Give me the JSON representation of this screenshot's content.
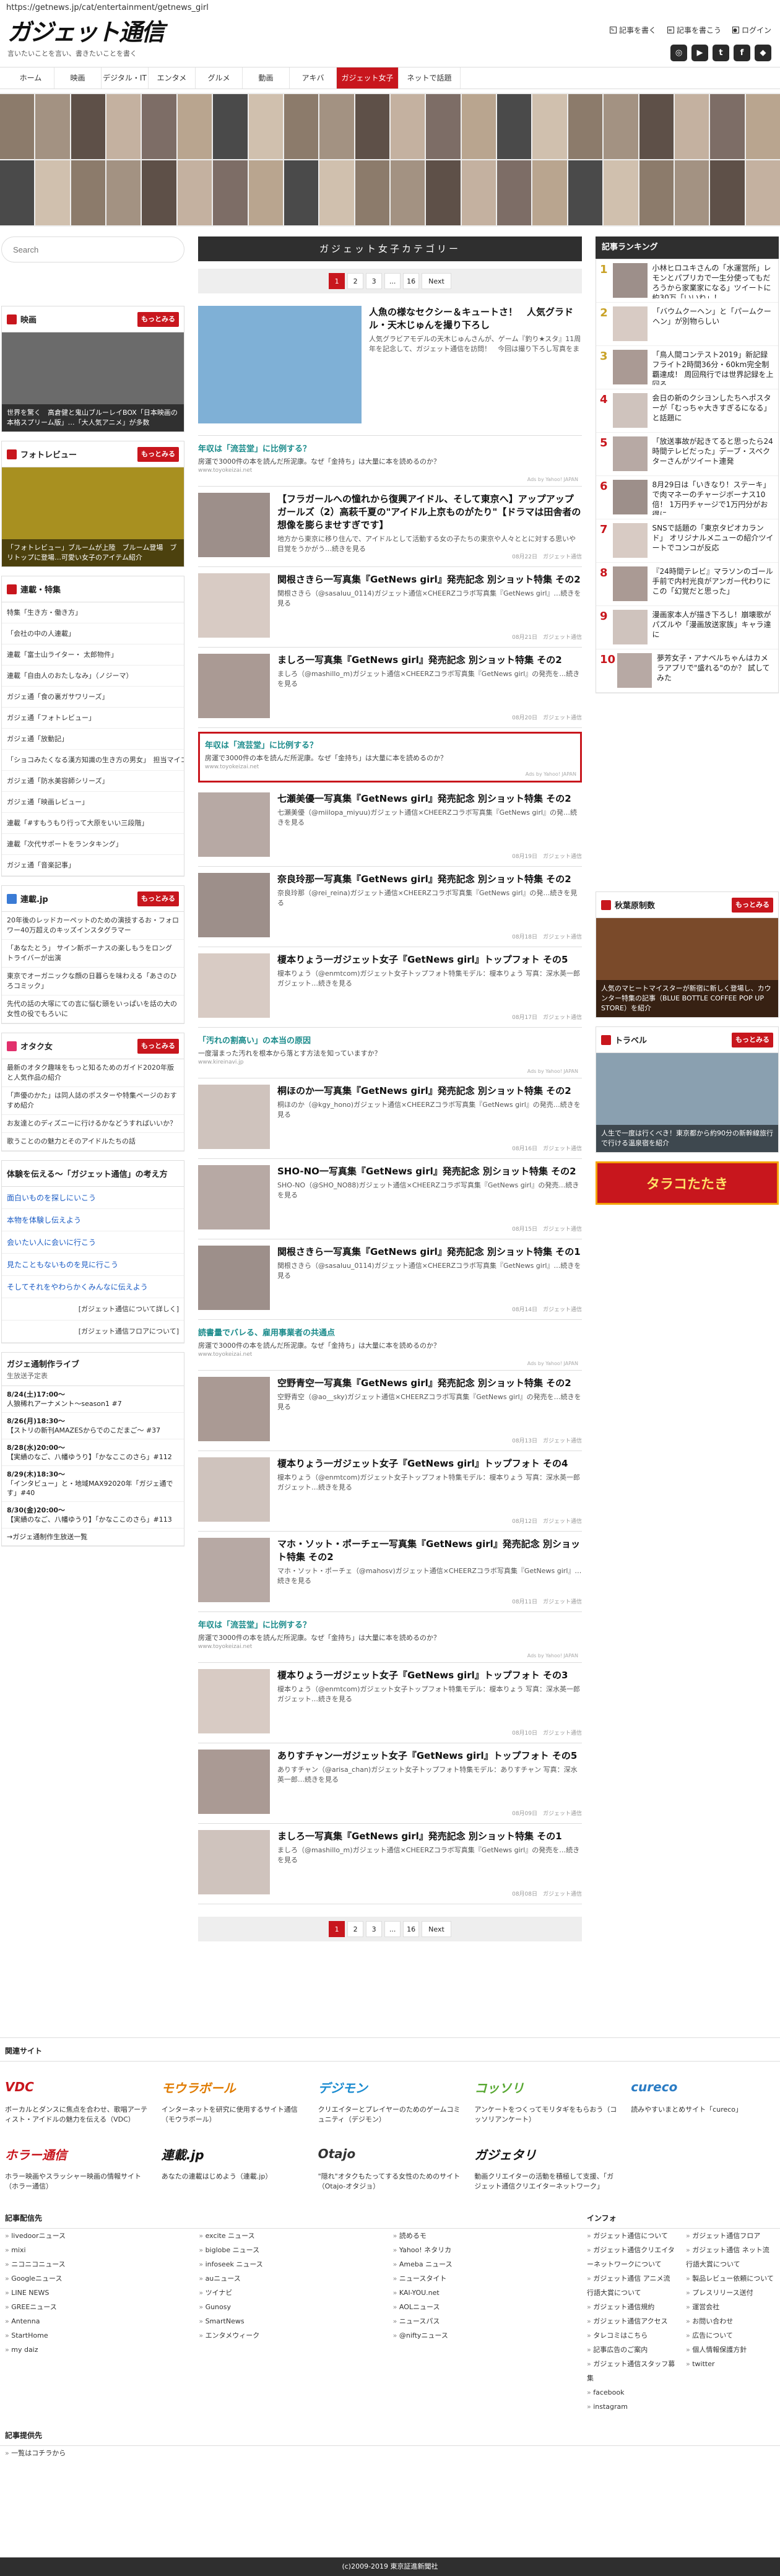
{
  "url": "https://getnews.jp/cat/entertainment/getnews_girl",
  "site": {
    "logo": "ガジェット通信",
    "tagline": "言いたいことを言い、書きたいことを書く"
  },
  "top_links": [
    "記事を書く",
    "記事を書こう",
    "ログイン"
  ],
  "social": [
    {
      "label": "Instagram",
      "icon": "instagram-icon"
    },
    {
      "label": "YouTube",
      "icon": "youtube-icon"
    },
    {
      "label": "Twitter",
      "icon": "twitter-icon"
    },
    {
      "label": "Facebook",
      "icon": "facebook-icon"
    },
    {
      "label": "Feedly",
      "icon": "feedly-icon"
    }
  ],
  "nav": [
    "ホーム",
    "映画",
    "デジタル・IT",
    "エンタメ",
    "グルメ",
    "動画",
    "アキバ",
    "ガジェット女子",
    "ネットで話題"
  ],
  "nav_active": "ガジェット女子",
  "search_placeholder": "Search",
  "left": {
    "box1": {
      "title": "映画",
      "more": "もっとみる",
      "caption": "世界を驚く　高倉健と鬼山ブルーレイBOX「日本映画の本格スプリーム版」…「大人気アニメ」が多数"
    },
    "box2": {
      "title": "フォトレビュー",
      "more": "もっとみる",
      "caption": "「フォトレビュー」ブルームが上陸　ブルーム登場　ブリトップに登場…可愛い女子のアイテム紹介"
    },
    "feature_title": "連載・特集",
    "features": [
      "特集「生き方・働き方」",
      "「会社の中の人連載」",
      "連載「富士山ライター・ 太郎物件」",
      "連載「自由人のおたしなみ」（ノジーマ）",
      "ガジェ通「食の裏ガサワリーズ」",
      "ガジェ通「フォトレビュー」",
      "ガジェ通「放動記」",
      "「ショコみたくなる漢方知識の生き方の男女」　担当マイコ",
      "ガジェ通「防水美容師シリーズ」",
      "ガジェ通「映画レビュー」",
      "連載「#すもうもり行って大原をいい三段階」",
      "連載「次代サポートをランタキング」",
      "ガジェ通「音楽記事」"
    ],
    "rensai": {
      "title": "連載.jp",
      "more": "もっとみる",
      "items": [
        "20年後のレッドカーペットのための演技するお・フォロワー40万超えのキッズインスタグラマー",
        "「あなたとう」 サイン新ボーナスの楽しもうをロングトライバーが出演",
        "東京でオーガニックな顔の日暮らを味わえる「あさのひろコミック」",
        "先代の話の大塚にての言に悩む頭をいっぱいを話の大の女性の役でもろいに"
      ]
    },
    "otaku": {
      "title": "オタク女",
      "more": "もっとみる",
      "items": [
        "最新のオタク趣味をもっと知るためのガイド2020年版と人気作品の紹介",
        "「声優のかた」は同人誌のポスターや特集ページのおすすめ紹介",
        "お友達とのディズニーに行けるかなどうすればいいか？",
        "歌うことのの魅力とそのアイドルたちの話"
      ]
    },
    "theme_title": "体験を伝える～「ガジェット通信」の考え方",
    "themes": [
      "面白いものを探しにいこう",
      "本物を体験し伝えよう",
      "会いたい人に会いに行こう",
      "見たこともないものを見に行こう",
      "そしてそれをやわらかくみんなに伝えよう"
    ],
    "theme_subs": [
      "[ガジェット通信について詳しく]",
      "[ガジェット通信フロアについて]"
    ],
    "schedule_title": "ガジェ通制作ライブ",
    "schedule_sub": "生放送予定表",
    "schedule": [
      {
        "date": "8/24(土)17:00〜",
        "text": "人狼稀れアーナメント～season1 #7"
      },
      {
        "date": "8/26(月)18:30〜",
        "text": "【ストリの新刊AMAZESからでのこだまご〜 #37"
      },
      {
        "date": "8/28(水)20:00〜",
        "text": "【実績のなご、八幡ゆうり】「かなここのさら」#112"
      },
      {
        "date": "8/29(木)18:30〜",
        "text": "「インタビュー」と・地域MAX92020年「ガジェ通です」#40"
      },
      {
        "date": "8/30(金)20:00〜",
        "text": "【実績のなご、八幡ゆうり】「かなここのさら」#113"
      }
    ],
    "schedule_more": "→ガジェ通制作生放送一覧"
  },
  "main": {
    "category_title": "ガジェット女子カテゴリー",
    "pager": {
      "pages": [
        "1",
        "2",
        "3",
        "...",
        "16"
      ],
      "current": "1",
      "next": "Next"
    },
    "articles": [
      {
        "type": "big",
        "title": "人魚の様なセクシー＆キュートさ！　人気グラドル・天木じゅんを撮り下ろし",
        "desc": "人気グラビアモデルの天木じゅんさんが、ゲーム『釣り★スタ』11周年を記念して、ガジェット通信を訪問！　今回は撮り下ろし写真をまとめてご紹介します。【インタビューはこちらから】天木じゅんが『釣り★スタ…','meta':'08月24日　ガジェット通信"
      },
      {
        "type": "ad",
        "title": "年収は「流芸堂」に比例する？",
        "desc": "房運で3000件の本を読んだ所泥康。なぜ「金持ち」は大量に本を読めるのか？",
        "host": "www.toyokeizai.net",
        "by": "Ads by Yahoo! JAPAN"
      },
      {
        "type": "small",
        "title": "【フラガールへの憧れから復興アイドル、そして東京へ】アップアップガールズ（2）高萩千夏の\"アイドル上京ものがたり\"【ドラマは田舎者の想像を膨らませすぎです】",
        "desc": "地方から東京に移り住んで、アイドルとして活動する女の子たちの東京や人々ととに対する思いや目覚をうかがう…続きを見る",
        "meta": "08月22日　ガジェット通信"
      },
      {
        "type": "small",
        "title": "関根さきら一写真集『GetNews girl』発売記念 別ショット特集 その2",
        "desc": "関根さきら（@sasaluu_0114)ガジェット通信×CHEERZコラボ写真集『GetNews girl』…続きを見る",
        "meta": "08月21日　ガジェット通信"
      },
      {
        "type": "small",
        "title": "ましろ一写真集『GetNews girl』発売記念 別ショット特集 その2",
        "desc": "ましろ（@mashillo_m)ガジェット通信×CHEERZコラボ写真集『GetNews girl』の発売を…続きを見る",
        "meta": "08月20日　ガジェット通信"
      },
      {
        "type": "ad-boxed",
        "title": "年収は「流芸堂」に比例する？",
        "desc": "房運で3000件の本を読んだ所泥康。なぜ「金持ち」は大量に本を読めるのか？",
        "host": "www.toyokeizai.net",
        "by": "Ads by Yahoo! JAPAN"
      },
      {
        "type": "small",
        "title": "七瀬美優一写真集『GetNews girl』発売記念 別ショット特集 その2",
        "desc": "七瀬美優（@miilopa_miyuu)ガジェット通信×CHEERZコラボ写真集『GetNews girl』の発…続きを見る",
        "meta": "08月19日　ガジェット通信"
      },
      {
        "type": "small",
        "title": "奈良玲那一写真集『GetNews girl』発売記念 別ショット特集 その2",
        "desc": "奈良玲那（@rei_reina)ガジェット通信×CHEERZコラボ写真集『GetNews girl』の発…続きを見る",
        "meta": "08月18日　ガジェット通信"
      },
      {
        "type": "small",
        "title": "榎本りょう一ガジェット女子『GetNews girl』トップフォト その5",
        "desc": "榎本りょう（@enmtcom)ガジェット女子トップフォト特集モデル：榎本りょう 写真：深水英一郎ガジェット…続きを見る",
        "meta": "08月17日　ガジェット通信"
      },
      {
        "type": "ad",
        "title": "「汚れの割高い」の本当の原因",
        "desc": "一度溜まった汚れを根本から落とす方法を知っていますか？",
        "host": "www.kireinavi.jp",
        "by": "Ads by Yahoo! JAPAN"
      },
      {
        "type": "small",
        "title": "桐ほのか一写真集『GetNews girl』発売記念 別ショット特集 その2",
        "desc": "桐ほのか（@kgy_hono)ガジェット通信×CHEERZコラボ写真集『GetNews girl』の発売…続きを見る",
        "meta": "08月16日　ガジェット通信"
      },
      {
        "type": "small",
        "title": "SHO-NO一写真集『GetNews girl』発売記念 別ショット特集 その2",
        "desc": "SHO-NO（@SHO_NO88)ガジェット通信×CHEERZコラボ写真集『GetNews girl』の発売…続きを見る",
        "meta": "08月15日　ガジェット通信"
      },
      {
        "type": "small",
        "title": "関根さきら一写真集『GetNews girl』発売記念 別ショット特集 その1",
        "desc": "関根さきら（@sasaluu_0114)ガジェット通信×CHEERZコラボ写真集『GetNews girl』…続きを見る",
        "meta": "08月14日　ガジェット通信"
      },
      {
        "type": "ad",
        "title": "読書量でバレる、雇用事業者の共通点",
        "desc": "房運で3000件の本を読んだ所泥康。なぜ「金持ち」は大量に本を読めるのか？",
        "host": "www.toyokeizai.net",
        "by": "Ads by Yahoo! JAPAN"
      },
      {
        "type": "small",
        "title": "空野青空一写真集『GetNews girl』発売記念 別ショット特集 その2",
        "desc": "空野青空（@ao__sky)ガジェット通信×CHEERZコラボ写真集『GetNews girl』の発売を…続きを見る",
        "meta": "08月13日　ガジェット通信"
      },
      {
        "type": "small",
        "title": "榎本りょう一ガジェット女子『GetNews girl』トップフォト その4",
        "desc": "榎本りょう（@enmtcom)ガジェット女子トップフォト特集モデル：榎本りょう 写真：深水英一郎ガジェット…続きを見る",
        "meta": "08月12日　ガジェット通信"
      },
      {
        "type": "small",
        "title": "マホ・ソット・ポーチェ一写真集『GetNews girl』発売記念 別ショット特集 その2",
        "desc": "マホ・ソット・ポーチェ（@mahosv)ガジェット通信×CHEERZコラボ写真集『GetNews girl』…続きを見る",
        "meta": "08月11日　ガジェット通信"
      },
      {
        "type": "ad",
        "title": "年収は「流芸堂」に比例する？",
        "desc": "房運で3000件の本を読んだ所泥康。なぜ「金持ち」は大量に本を読めるのか？",
        "host": "www.toyokeizai.net",
        "by": "Ads by Yahoo! JAPAN"
      },
      {
        "type": "small",
        "title": "榎本りょう一ガジェット女子『GetNews girl』トップフォト その3",
        "desc": "榎本りょう（@enmtcom)ガジェット女子トップフォト特集モデル：榎本りょう 写真：深水英一郎ガジェット…続きを見る",
        "meta": "08月10日　ガジェット通信"
      },
      {
        "type": "small",
        "title": "ありすチャン一ガジェット女子『GetNews girl』トップフォト その5",
        "desc": "ありすチャン（@arisa_chan)ガジェット女子トップフォト特集モデル：ありすチャン 写真：深水英一郎…続きを見る",
        "meta": "08月09日　ガジェット通信"
      },
      {
        "type": "small",
        "title": "ましろ一写真集『GetNews girl』発売記念 別ショット特集 その1",
        "desc": "ましろ（@mashillo_m)ガジェット通信×CHEERZコラボ写真集『GetNews girl』の発売を…続きを見る",
        "meta": "08月08日　ガジェット通信"
      }
    ]
  },
  "right": {
    "ranking_title": "記事ランキング",
    "ranking": [
      "小林ヒロユキさんの「水運営所」レモンとパプリカで一生分使ってもだろうから家業家になる」ツイートに約30万「いいね」！",
      "「バウムクーヘン」と「パームクーヘン」が別物らしい",
      "「鳥人間コンテスト2019」新記録 フライト2時間36分・60km完全制覇達成！ 周回飛行では世界記録を上回る",
      "会日の新のクシヨンしたちへポスターが「むっちゃ大きすぎるになる」と話題に",
      "「放送事故が起きてると思ったら24時間テレビだった」デーブ・スペクターさんがツイート連発",
      "8月29日は「いきなり！ステーキ」で肉マネーのチャージボーナス10倍！ 1万円チャージで1万円分がお得に",
      "SNSで話題の「東京タピオカランド」 オリジナルメニューの紹介ツイートでコンコが反応",
      "『24時間テレビ』マラソンのゴール手前で内村光良がアンガー代わりにこの「幻覚だと思った」",
      "漫画家本人が描き下ろし！崩壊歌がパズルや「漫画放送家族」キャラ達に",
      "夢芳女子・アナベルちゃんはカメラアプリで\"盛れる\"のか？ 試してみた"
    ],
    "box1": {
      "title": "秋葉原制数",
      "more": "もっとみる",
      "caption": "人気のマヒートマイスターが新宿に新しく登場し、カウンター特集の記事（BLUE BOTTLE COFFEE POP UP STORE）を紹介"
    },
    "box2": {
      "title": "トラベル",
      "more": "もっとみる",
      "caption": "人生で一度は行くべき！東京都から約90分の新幹線旅行で行ける温泉宿を紹介"
    },
    "promo": "タラコたたき"
  },
  "footer": {
    "related_title": "関連サイト",
    "related": [
      {
        "logo": "VDC",
        "desc": "ボーカルとダンスに焦点を合わせ、歌唱アーティスト・アイドルの魅力を伝える（VDC）"
      },
      {
        "logo": "モウラボール",
        "desc": "インターネットを研究に使用するサイト通信（モウラボール）"
      },
      {
        "logo": "デジモン",
        "desc": "クリエイターとプレイヤーのためのゲームコミュニティ（デジモン）"
      },
      {
        "logo": "コッソリ",
        "desc": "アンケートをつくってモリタギをもらおう（コッソリアンケート）"
      },
      {
        "logo": "cureco",
        "desc": "読みやすいまとめサイト「cureco」"
      },
      {
        "logo": "ホラー通信",
        "desc": "ホラー映画やスラッシャー映画の情報サイト（ホラー通信）"
      },
      {
        "logo": "連載.jp",
        "desc": "あなたの連載はじめよう（連載.jp）"
      },
      {
        "logo": "Otajo",
        "desc": "\"隠れ\"オタクもたってする女性のためのサイト（Otajo-オタジョ）"
      },
      {
        "logo": "ガジェタリ",
        "desc": "動画クリエイターの活動を積極して支援、「ガジェット通信クリエイターネットワーク」"
      }
    ],
    "provider_title": "記事配信先",
    "providers": [
      [
        "livedoorニュース",
        "mixi",
        "ニコニコニュース",
        "Googleニュース",
        "LINE NEWS",
        "GREEニュース",
        "Antenna",
        "StartHome",
        "my daiz"
      ],
      [
        "excite ニュース",
        "biglobe ニュース",
        "infoseek ニュース",
        "auニュース",
        "ツイナビ",
        "Gunosy",
        "SmartNews",
        "エンタメウィーク"
      ],
      [
        "読めるモ",
        "Yahoo! ネタリカ",
        "Ameba ニュース",
        "ニュースタイト",
        "KAI-YOU.net",
        "AOLニュース",
        "ニュースパス",
        "@niftyニュース"
      ]
    ],
    "info_title": "インフォ",
    "info_left": [
      "ガジェット通信について",
      "ガジェット通信クリエイターネットワークについて",
      "ガジェット通信 アニメ流行語大賞について",
      "ガジェット通信規約",
      "ガジェット通信アクセス",
      "タレコミはこちら",
      "記事広告のご案内",
      "ガジェット通信スタッフ募集",
      "facebook",
      "instagram"
    ],
    "info_right": [
      "ガジェット通信フロア",
      "ガジェット通信 ネット流行語大賞について",
      "製品レビュー依頼について",
      "プレスリリース送付",
      "運営会社",
      "お問い合わせ",
      "広告について",
      "個人情報保護方針",
      "twitter"
    ],
    "provider2_title": "記事提供先",
    "provider2": "一覧はコチラから",
    "copyright": "(c)2009-2019 東京証進新聞社"
  },
  "colors": {
    "accent": "#c8161d",
    "dark": "#2f2f2f",
    "link": "#1a5bc4"
  }
}
